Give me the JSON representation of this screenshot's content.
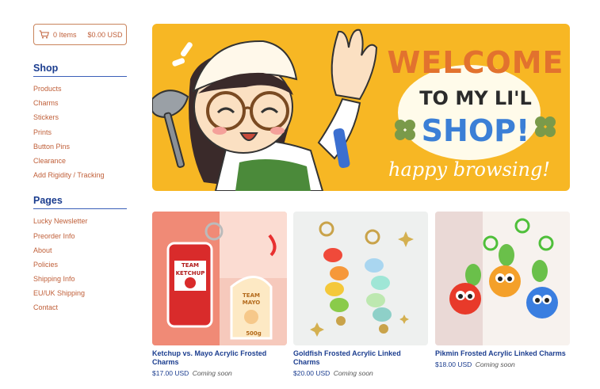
{
  "cart": {
    "items_label": "0 Items",
    "total_label": "$0.00 USD",
    "icon": "shopping-cart-icon"
  },
  "sidebar": {
    "shop_title": "Shop",
    "shop_items": [
      {
        "label": "Products"
      },
      {
        "label": "Charms"
      },
      {
        "label": "Stickers"
      },
      {
        "label": "Prints"
      },
      {
        "label": "Button Pins"
      },
      {
        "label": "Clearance"
      },
      {
        "label": "Add Rigidity / Tracking"
      }
    ],
    "pages_title": "Pages",
    "pages_items": [
      {
        "label": "Lucky Newsletter"
      },
      {
        "label": "Preorder Info"
      },
      {
        "label": "About"
      },
      {
        "label": "Policies"
      },
      {
        "label": "Shipping Info"
      },
      {
        "label": "EU/UK Shipping"
      },
      {
        "label": "Contact"
      }
    ]
  },
  "banner": {
    "line1": "WELCOME",
    "line2": "TO MY LI'L",
    "line3": "SHOP!",
    "tagline": "happy browsing!",
    "background": "#f7b724"
  },
  "products": [
    {
      "title": "Ketchup vs. Mayo Acrylic Frosted Charms",
      "price": "$17.00 USD",
      "status": "Coming soon",
      "label_a_top": "TEAM",
      "label_a_bottom": "KETCHUP",
      "label_b_top": "TEAM",
      "label_b_bottom": "MAYO",
      "label_b_amount": "500g"
    },
    {
      "title": "Goldfish Frosted Acrylic Linked Charms",
      "price": "$20.00 USD",
      "status": "Coming soon"
    },
    {
      "title": "Pikmin Frosted Acrylic Linked Charms",
      "price": "$18.00 USD",
      "status": "Coming soon"
    }
  ],
  "colors": {
    "link": "#c0603a",
    "heading": "#1b3d8f",
    "banner_yellow": "#f7b724"
  }
}
